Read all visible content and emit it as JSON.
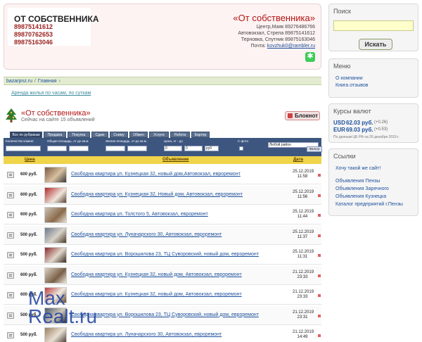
{
  "header": {
    "logo_title": "ОТ СОБСТВЕННИКА",
    "phones": [
      "89875141612",
      "89870762653",
      "89875163046"
    ],
    "brand_name": "«От собственника»",
    "contact_lines": [
      "Центр,Маяк 89276486766",
      "Автовокзал, Стрела 89875141612",
      "Терновка, Спутник 89875163046"
    ],
    "email_label": "Почта:",
    "email": "kovzhuk0@rambler.ru"
  },
  "search": {
    "title": "Поиск",
    "value": "",
    "button": "Искать"
  },
  "menu": {
    "title": "Меню",
    "items": [
      "О компании",
      "Книга отзывов"
    ]
  },
  "currency": {
    "title": "Курсы валют",
    "rates": [
      {
        "code": "USD",
        "value": "62.03 руб.",
        "delta": "(+0.26)"
      },
      {
        "code": "EUR",
        "value": "69.03 руб.",
        "delta": "(+0.53)"
      }
    ],
    "note": "По данным ЦБ РФ на 26 декабря 2019 г."
  },
  "links": {
    "title": "Ссылки",
    "items": [
      "Хочу такой же сайт!",
      "Объявления Пензы",
      "Объявления Заречного",
      "Объявления Кузнецка",
      "Каталог предприятий г.Пензы"
    ]
  },
  "breadcrumb": {
    "items": [
      "bazarpnz.ru",
      "Главная"
    ],
    "separators": [
      "/",
      "›"
    ]
  },
  "sub_link": "Аренда жилья по часам, по суткам",
  "section": {
    "title": "«От собственника»",
    "subtitle": "Сейчас на сайте 15 объявлений",
    "notebook_button": "Блокнот"
  },
  "tabs": [
    "Все по рубрикам",
    "Продажа",
    "Покупка",
    "Сдаю",
    "Сниму",
    "Обмен",
    "Услуги",
    "Работа",
    "Бартер"
  ],
  "filters": {
    "rooms_label": "Количество комнат",
    "total_area_label": "Общая площадь, от-до кв.м.",
    "living_area_label": "Жилая площадь, от-до кв.м.",
    "price_label": "Цена, от - до",
    "photo_label": "С фото",
    "area_select": "Любой район",
    "from_value": "0",
    "to_value": "0",
    "currency_select": "руб",
    "filter_button": "Фильтр"
  },
  "list_head": {
    "price": "Цена",
    "listing": "Объявление",
    "date": "Дата"
  },
  "listings": [
    {
      "price": "600 руб.",
      "title": "Свободна квартира ул. Кузнецкая 32, новый дом,Автовокзал, евроремонт",
      "date": "25.12.2019",
      "time": "11:58"
    },
    {
      "price": "600 руб.",
      "title": "Свободна квартира ул. Кузнецкая 32, Новый дом, Автовокзал, евроремонт",
      "date": "25.12.2019",
      "time": "11:56"
    },
    {
      "price": "600 руб.",
      "title": "Свободна квартира ул. Толстого 5, Автовокзал, евроремонт",
      "date": "25.12.2019",
      "time": "11:44"
    },
    {
      "price": "500 руб.",
      "title": "Свободна квартира ул. Луначарского 30, Автовокзал, евроремонт",
      "date": "25.12.2019",
      "time": "11:37"
    },
    {
      "price": "500 руб.",
      "title": "Свободна квартира ул. Ворошилова 23, ТЦ Суворовский, новый дом, евроремонт",
      "date": "25.12.2019",
      "time": "11:31"
    },
    {
      "price": "600 руб.",
      "title": "Свободна квартира ул. Кузнецкая 32, новый дом, Автовокзал, евроремонт",
      "date": "21.12.2019",
      "time": "23:33"
    },
    {
      "price": "600 руб.",
      "title": "Свободна квартира ул. Кузнецкая 32, новый дом, Автовокзал, евроремонт",
      "date": "21.12.2019",
      "time": "23:33"
    },
    {
      "price": "500 руб.",
      "title": "Свободна квартира ул. Ворошилова 23, ТЦ Суворовский, новый дом, евроремонт",
      "date": "21.12.2019",
      "time": "23:31"
    },
    {
      "price": "500 руб.",
      "title": "Свободна квартира ул. Луначарского 30, Автовокзал, евроремонт",
      "date": "21.12.2019",
      "time": "14:49"
    }
  ],
  "watermark": {
    "line1": "Max",
    "line2": "Realt.ru"
  }
}
